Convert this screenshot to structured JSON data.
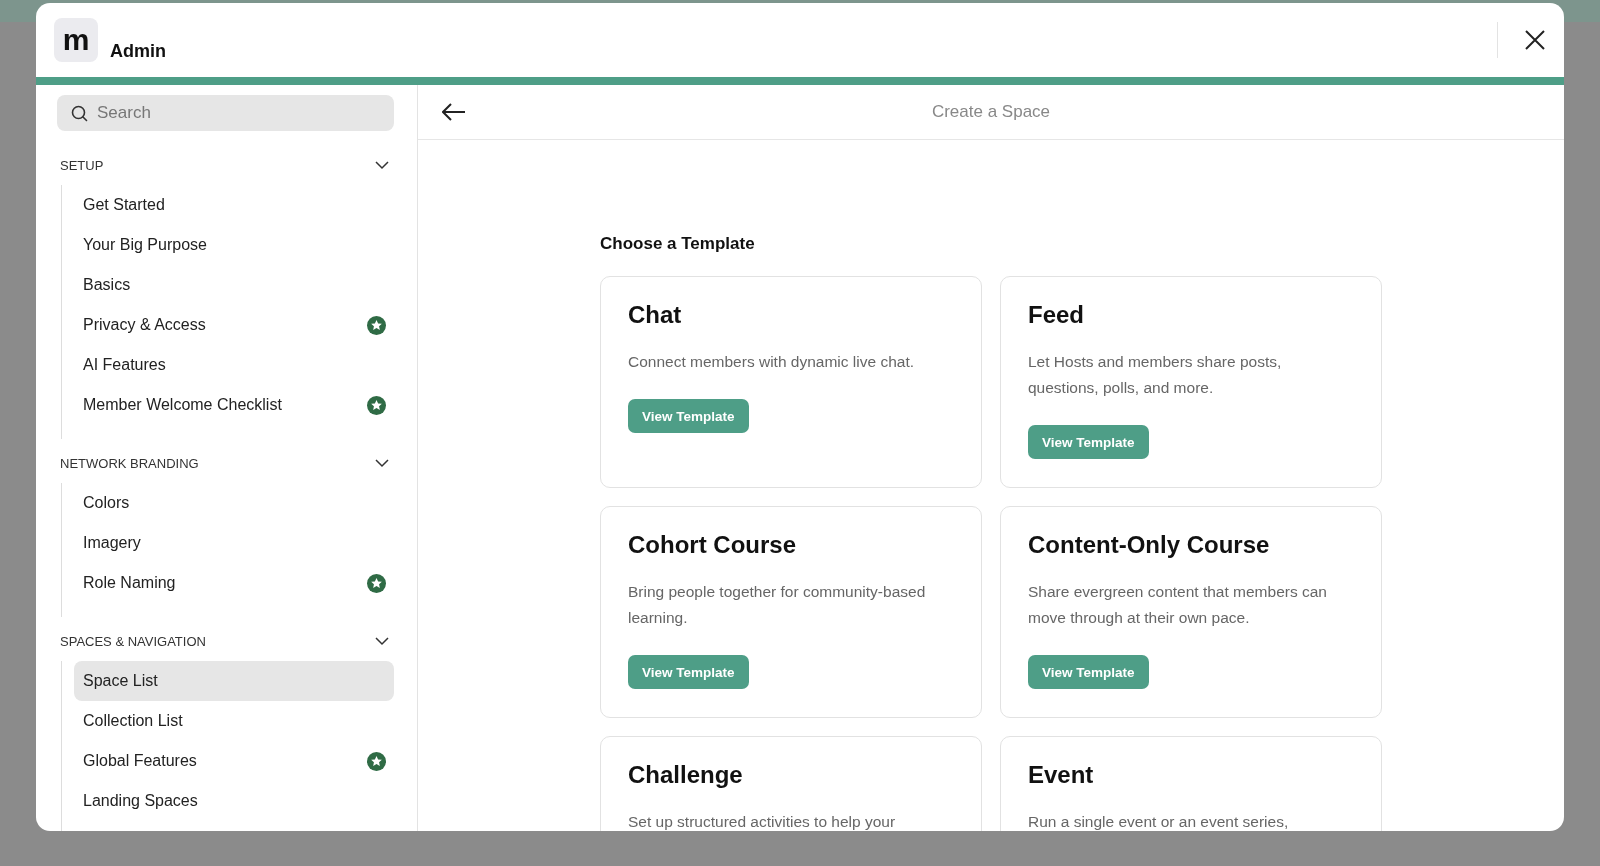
{
  "header": {
    "logo": "m",
    "title": "Admin"
  },
  "sidebar": {
    "search": {
      "placeholder": "Search"
    },
    "sections": [
      {
        "title": "SETUP",
        "expanded": true,
        "items": [
          {
            "label": "Get Started",
            "starred": false,
            "selected": false
          },
          {
            "label": "Your Big Purpose",
            "starred": false,
            "selected": false
          },
          {
            "label": "Basics",
            "starred": false,
            "selected": false
          },
          {
            "label": "Privacy & Access",
            "starred": true,
            "selected": false
          },
          {
            "label": "AI Features",
            "starred": false,
            "selected": false
          },
          {
            "label": "Member Welcome Checklist",
            "starred": true,
            "selected": false
          }
        ]
      },
      {
        "title": "NETWORK BRANDING",
        "expanded": true,
        "items": [
          {
            "label": "Colors",
            "starred": false,
            "selected": false
          },
          {
            "label": "Imagery",
            "starred": false,
            "selected": false
          },
          {
            "label": "Role Naming",
            "starred": true,
            "selected": false
          }
        ]
      },
      {
        "title": "SPACES & NAVIGATION",
        "expanded": true,
        "items": [
          {
            "label": "Space List",
            "starred": false,
            "selected": true
          },
          {
            "label": "Collection List",
            "starred": false,
            "selected": false
          },
          {
            "label": "Global Features",
            "starred": true,
            "selected": false
          },
          {
            "label": "Landing Spaces",
            "starred": false,
            "selected": false
          }
        ]
      }
    ]
  },
  "main": {
    "title": "Create a Space",
    "heading": "Choose a Template",
    "templates": [
      {
        "title": "Chat",
        "description": "Connect members with dynamic live chat.",
        "button": "View Template"
      },
      {
        "title": "Feed",
        "description": "Let Hosts and members share posts, questions, polls, and more.",
        "button": "View Template"
      },
      {
        "title": "Cohort Course",
        "description": "Bring people together for community-based learning.",
        "button": "View Template"
      },
      {
        "title": "Content-Only Course",
        "description": "Share evergreen content that members can move through at their own pace.",
        "button": "View Template"
      },
      {
        "title": "Challenge",
        "description": "Set up structured activities to help your"
      },
      {
        "title": "Event",
        "description": "Run a single event or an event series,"
      }
    ]
  }
}
